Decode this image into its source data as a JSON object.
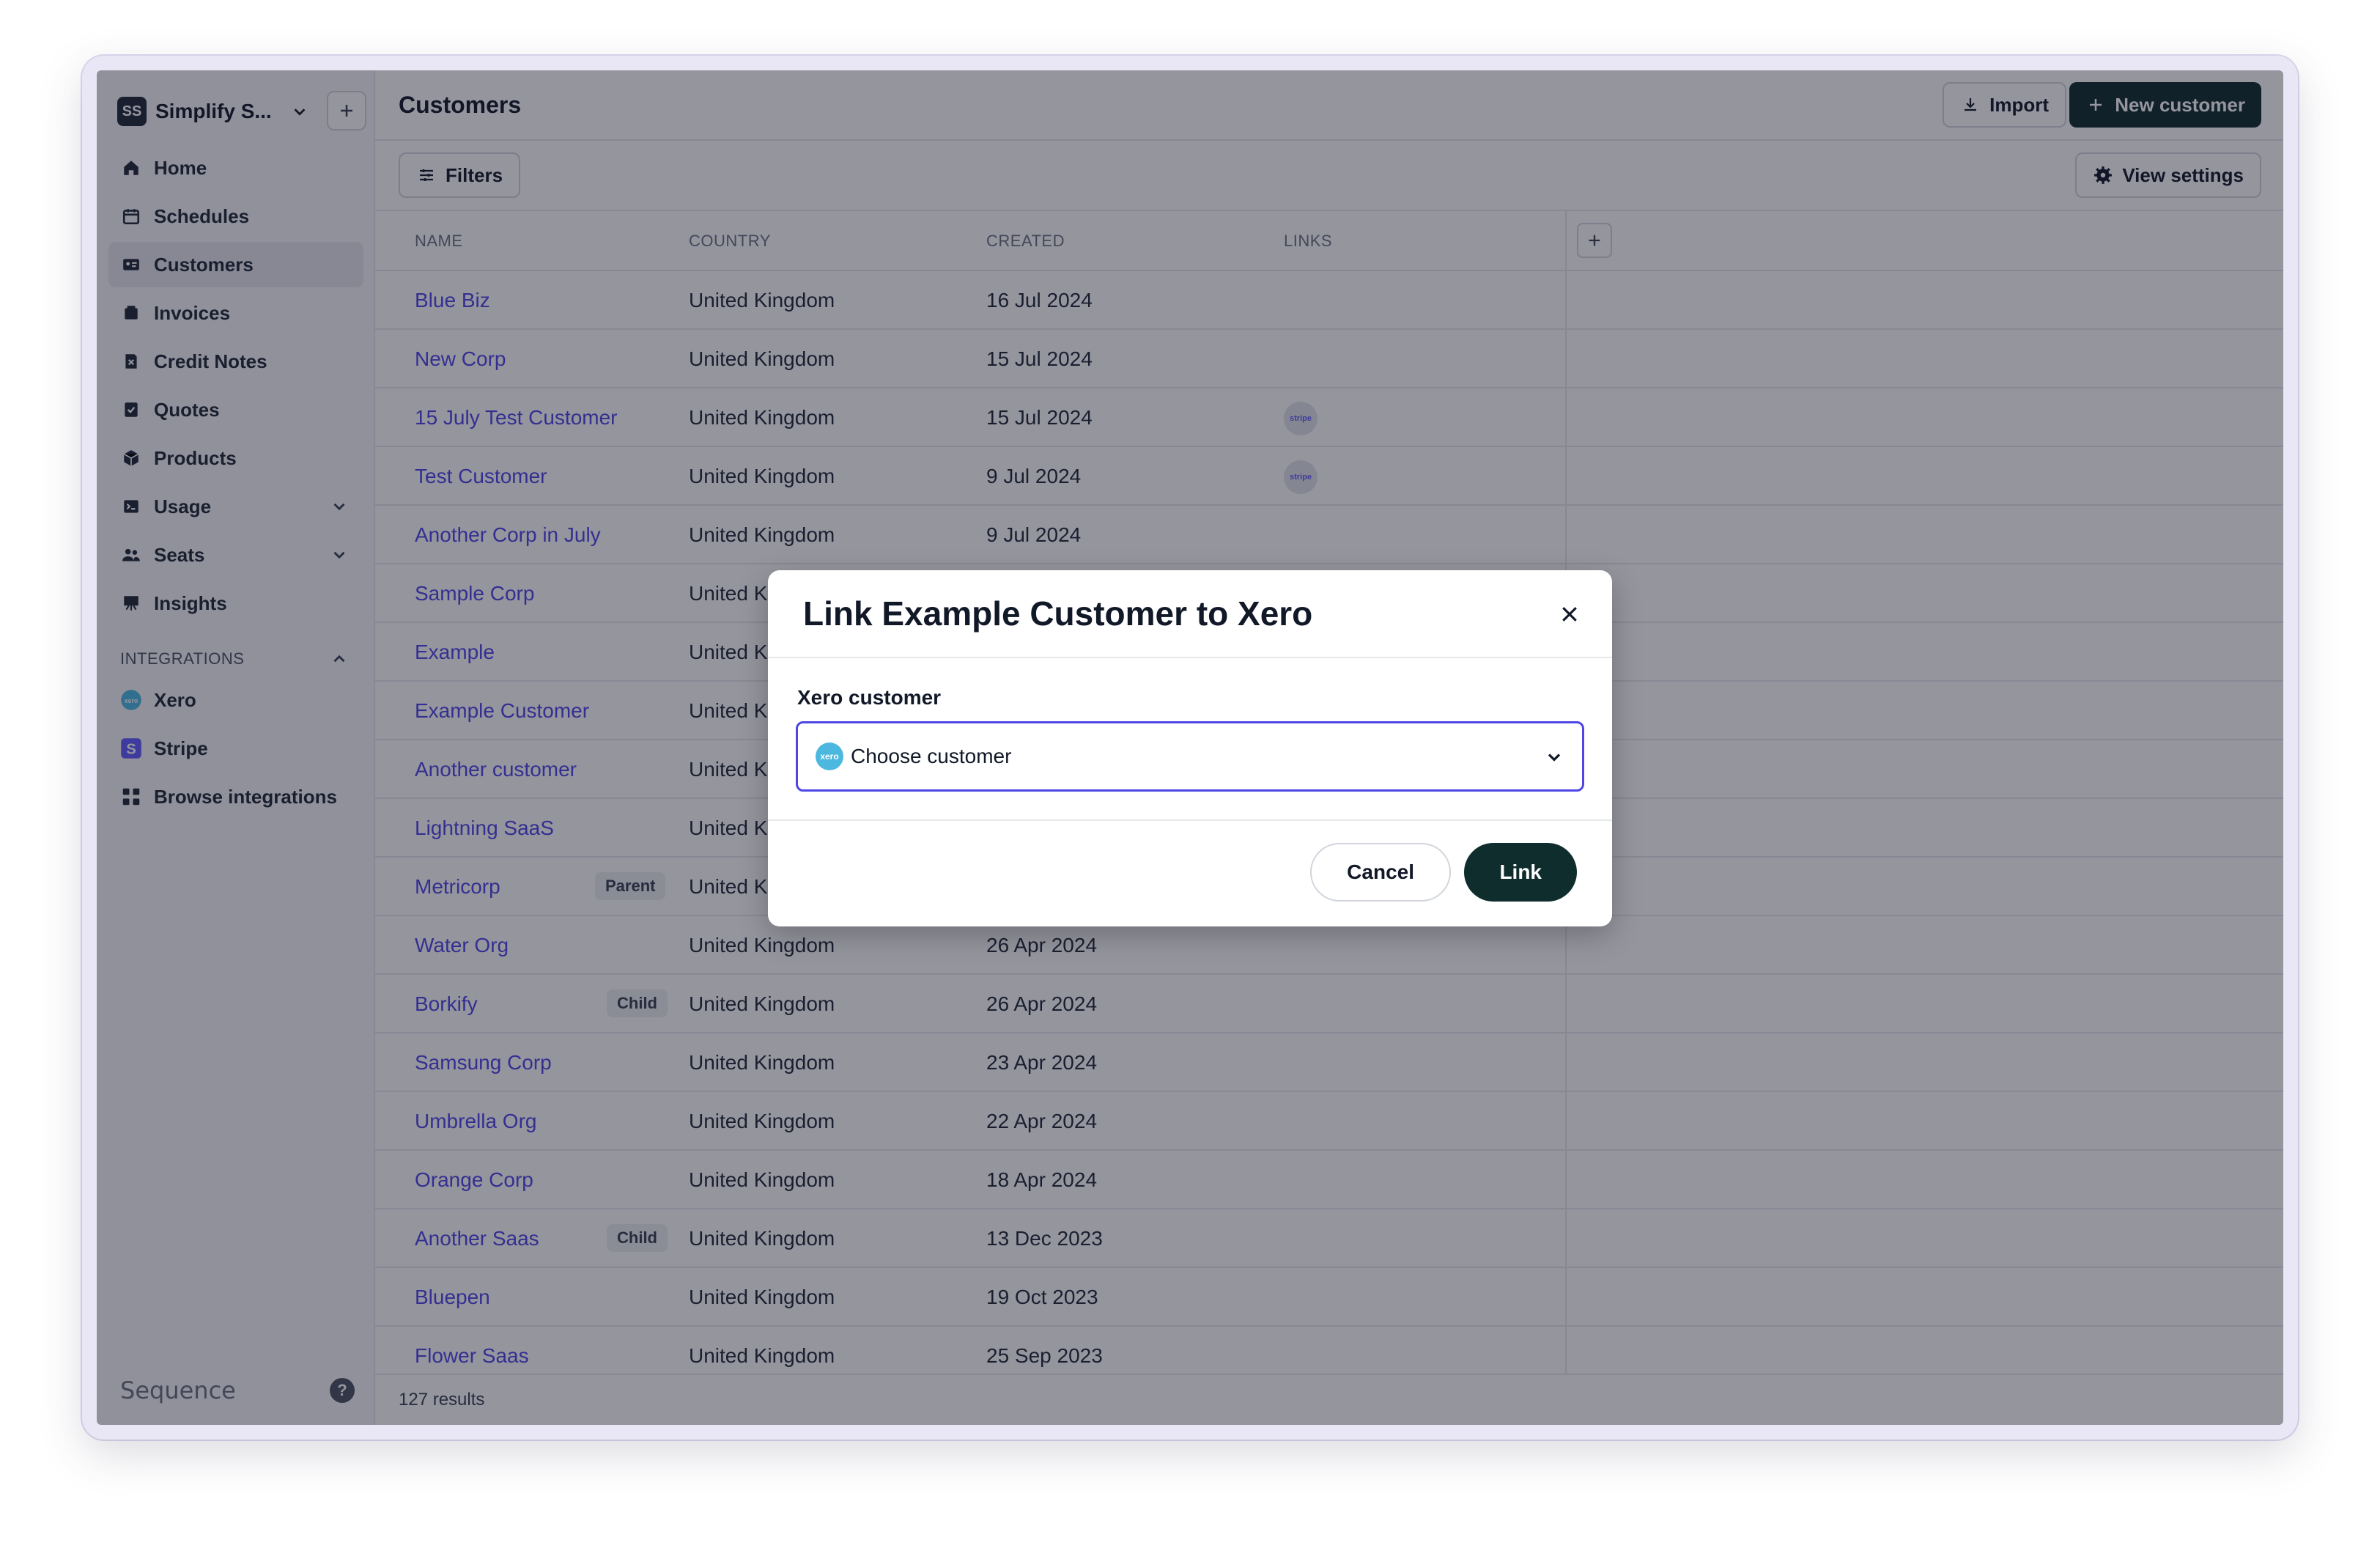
{
  "workspace": {
    "initials": "SS",
    "name": "Simplify S..."
  },
  "nav": {
    "items": [
      {
        "label": "Home",
        "icon": "home-icon"
      },
      {
        "label": "Schedules",
        "icon": "calendar-icon"
      },
      {
        "label": "Customers",
        "icon": "id-card-icon",
        "active": true
      },
      {
        "label": "Invoices",
        "icon": "invoice-icon"
      },
      {
        "label": "Credit Notes",
        "icon": "credit-note-icon"
      },
      {
        "label": "Quotes",
        "icon": "quote-icon"
      },
      {
        "label": "Products",
        "icon": "box-icon"
      },
      {
        "label": "Usage",
        "icon": "terminal-icon",
        "expandable": true
      },
      {
        "label": "Seats",
        "icon": "users-icon",
        "expandable": true
      },
      {
        "label": "Insights",
        "icon": "chart-icon"
      }
    ],
    "integrations_heading": "INTEGRATIONS",
    "integrations": [
      {
        "label": "Xero",
        "icon": "xero-icon"
      },
      {
        "label": "Stripe",
        "icon": "stripe-icon"
      },
      {
        "label": "Browse integrations",
        "icon": "grid-icon"
      }
    ]
  },
  "footer": {
    "brand": "Sequence",
    "help": "?"
  },
  "header": {
    "title": "Customers",
    "import_label": "Import",
    "new_label": "New customer"
  },
  "toolbar": {
    "filters_label": "Filters",
    "view_settings_label": "View settings"
  },
  "table": {
    "columns": [
      "NAME",
      "COUNTRY",
      "CREATED",
      "LINKS"
    ],
    "rows": [
      {
        "name": "Blue Biz",
        "country": "United Kingdom",
        "created": "16 Jul 2024",
        "badge": "",
        "stripe": false
      },
      {
        "name": "New Corp",
        "country": "United Kingdom",
        "created": "15 Jul 2024",
        "badge": "",
        "stripe": false
      },
      {
        "name": "15 July Test Customer",
        "country": "United Kingdom",
        "created": "15 Jul 2024",
        "badge": "",
        "stripe": true
      },
      {
        "name": "Test Customer",
        "country": "United Kingdom",
        "created": "9 Jul 2024",
        "badge": "",
        "stripe": true
      },
      {
        "name": "Another Corp in July",
        "country": "United Kingdom",
        "created": "9 Jul 2024",
        "badge": "",
        "stripe": false
      },
      {
        "name": "Sample Corp",
        "country": "United K",
        "created": "",
        "badge": "",
        "stripe": false
      },
      {
        "name": "Example",
        "country": "United K",
        "created": "",
        "badge": "",
        "stripe": false
      },
      {
        "name": "Example Customer",
        "country": "United K",
        "created": "",
        "badge": "",
        "stripe": false
      },
      {
        "name": "Another customer",
        "country": "United K",
        "created": "",
        "badge": "",
        "stripe": false
      },
      {
        "name": "Lightning SaaS",
        "country": "United K",
        "created": "",
        "badge": "",
        "stripe": false
      },
      {
        "name": "Metricorp",
        "country": "United K",
        "created": "",
        "badge": "Parent",
        "stripe": false
      },
      {
        "name": "Water Org",
        "country": "United Kingdom",
        "created": "26 Apr 2024",
        "badge": "",
        "stripe": false
      },
      {
        "name": "Borkify",
        "country": "United Kingdom",
        "created": "26 Apr 2024",
        "badge": "Child",
        "stripe": false
      },
      {
        "name": "Samsung Corp",
        "country": "United Kingdom",
        "created": "23 Apr 2024",
        "badge": "",
        "stripe": false
      },
      {
        "name": "Umbrella Org",
        "country": "United Kingdom",
        "created": "22 Apr 2024",
        "badge": "",
        "stripe": false
      },
      {
        "name": "Orange Corp",
        "country": "United Kingdom",
        "created": "18 Apr 2024",
        "badge": "",
        "stripe": false
      },
      {
        "name": "Another Saas",
        "country": "United Kingdom",
        "created": "13 Dec 2023",
        "badge": "Child",
        "stripe": false
      },
      {
        "name": "Bluepen",
        "country": "United Kingdom",
        "created": "19 Oct 2023",
        "badge": "",
        "stripe": false
      },
      {
        "name": "Flower Saas",
        "country": "United Kingdom",
        "created": "25 Sep 2023",
        "badge": "",
        "stripe": false
      }
    ],
    "stripe_label": "stripe",
    "results": "127 results"
  },
  "modal": {
    "title": "Link Example Customer to Xero",
    "field_label": "Xero customer",
    "xero_logo_text": "xero",
    "select_placeholder": "Choose customer",
    "cancel_label": "Cancel",
    "link_label": "Link"
  },
  "colors": {
    "accent": "#4f46e5",
    "dark_button": "#0f2d2d",
    "xero": "#4cb8e0",
    "stripe": "#635bff"
  }
}
